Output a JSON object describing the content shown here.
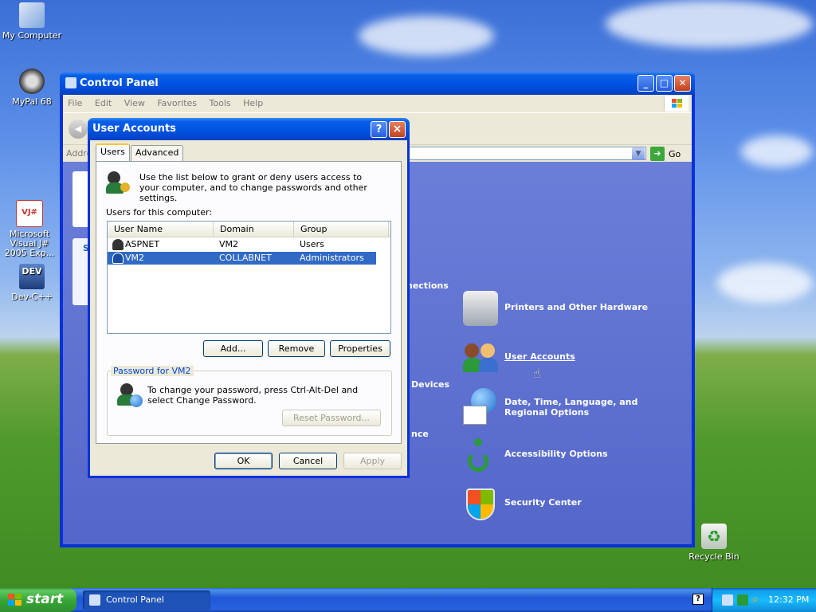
{
  "desktop": {
    "icons": [
      {
        "label": "My Computer"
      },
      {
        "label": "MyPal 68"
      },
      {
        "label": "Microsoft Visual J# 2005 Exp..."
      },
      {
        "label": "Dev-C++"
      },
      {
        "label": "Recycle Bin"
      }
    ],
    "icon_badges": {
      "vj": "VJ#",
      "dev": "DEV"
    }
  },
  "control_panel": {
    "title": "Control Panel",
    "menu": [
      "File",
      "Edit",
      "View",
      "Favorites",
      "Tools",
      "Help"
    ],
    "address_label": "Addre",
    "go_label": "Go",
    "categories_left_partial": [
      "nections",
      "Devices",
      "nce"
    ],
    "categories": [
      {
        "label": "Printers and Other Hardware",
        "icon": "printer-icon"
      },
      {
        "label": "User Accounts",
        "icon": "user-accounts-icon"
      },
      {
        "label": "Date, Time, Language, and Regional Options",
        "icon": "globe-calendar-icon"
      },
      {
        "label": "Accessibility Options",
        "icon": "accessibility-icon"
      },
      {
        "label": "Security Center",
        "icon": "shield-icon"
      }
    ],
    "partial_tile_letter": "S"
  },
  "dialog": {
    "title": "User Accounts",
    "help_glyph": "?",
    "close_glyph": "×",
    "tabs": [
      {
        "label": "Users"
      },
      {
        "label": "Advanced"
      }
    ],
    "intro": "Use the list below to grant or deny users access to your computer, and to change passwords and other settings.",
    "users_label": "Users for this computer:",
    "columns": [
      "User Name",
      "Domain",
      "Group"
    ],
    "rows": [
      {
        "name": "ASPNET",
        "domain": "VM2",
        "group": "Users"
      },
      {
        "name": "VM2",
        "domain": "COLLABNET",
        "group": "Administrators"
      }
    ],
    "buttons": {
      "add": "Add...",
      "remove": "Remove",
      "properties": "Properties"
    },
    "password_group": {
      "label": "Password for VM2",
      "text": "To change your password, press Ctrl-Alt-Del and select Change Password.",
      "reset_button": "Reset Password..."
    },
    "footer": {
      "ok": "OK",
      "cancel": "Cancel",
      "apply": "Apply"
    }
  },
  "taskbar": {
    "start_label": "start",
    "items": [
      {
        "label": "Control Panel"
      }
    ],
    "clock": "12:32 PM",
    "help_glyph": "?"
  }
}
